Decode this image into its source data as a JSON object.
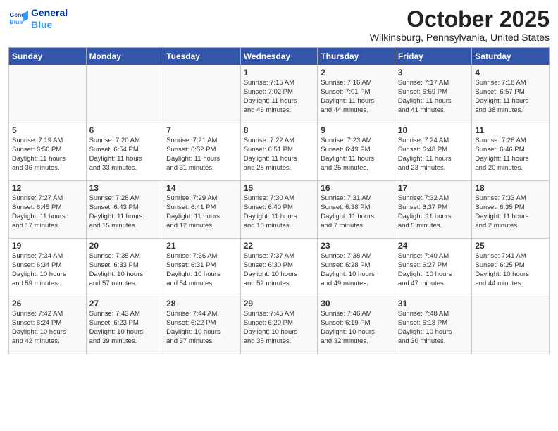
{
  "header": {
    "logo_line1": "General",
    "logo_line2": "Blue",
    "month": "October 2025",
    "location": "Wilkinsburg, Pennsylvania, United States"
  },
  "days_of_week": [
    "Sunday",
    "Monday",
    "Tuesday",
    "Wednesday",
    "Thursday",
    "Friday",
    "Saturday"
  ],
  "weeks": [
    [
      {
        "day": "",
        "text": ""
      },
      {
        "day": "",
        "text": ""
      },
      {
        "day": "",
        "text": ""
      },
      {
        "day": "1",
        "text": "Sunrise: 7:15 AM\nSunset: 7:02 PM\nDaylight: 11 hours\nand 46 minutes."
      },
      {
        "day": "2",
        "text": "Sunrise: 7:16 AM\nSunset: 7:01 PM\nDaylight: 11 hours\nand 44 minutes."
      },
      {
        "day": "3",
        "text": "Sunrise: 7:17 AM\nSunset: 6:59 PM\nDaylight: 11 hours\nand 41 minutes."
      },
      {
        "day": "4",
        "text": "Sunrise: 7:18 AM\nSunset: 6:57 PM\nDaylight: 11 hours\nand 38 minutes."
      }
    ],
    [
      {
        "day": "5",
        "text": "Sunrise: 7:19 AM\nSunset: 6:56 PM\nDaylight: 11 hours\nand 36 minutes."
      },
      {
        "day": "6",
        "text": "Sunrise: 7:20 AM\nSunset: 6:54 PM\nDaylight: 11 hours\nand 33 minutes."
      },
      {
        "day": "7",
        "text": "Sunrise: 7:21 AM\nSunset: 6:52 PM\nDaylight: 11 hours\nand 31 minutes."
      },
      {
        "day": "8",
        "text": "Sunrise: 7:22 AM\nSunset: 6:51 PM\nDaylight: 11 hours\nand 28 minutes."
      },
      {
        "day": "9",
        "text": "Sunrise: 7:23 AM\nSunset: 6:49 PM\nDaylight: 11 hours\nand 25 minutes."
      },
      {
        "day": "10",
        "text": "Sunrise: 7:24 AM\nSunset: 6:48 PM\nDaylight: 11 hours\nand 23 minutes."
      },
      {
        "day": "11",
        "text": "Sunrise: 7:26 AM\nSunset: 6:46 PM\nDaylight: 11 hours\nand 20 minutes."
      }
    ],
    [
      {
        "day": "12",
        "text": "Sunrise: 7:27 AM\nSunset: 6:45 PM\nDaylight: 11 hours\nand 17 minutes."
      },
      {
        "day": "13",
        "text": "Sunrise: 7:28 AM\nSunset: 6:43 PM\nDaylight: 11 hours\nand 15 minutes."
      },
      {
        "day": "14",
        "text": "Sunrise: 7:29 AM\nSunset: 6:41 PM\nDaylight: 11 hours\nand 12 minutes."
      },
      {
        "day": "15",
        "text": "Sunrise: 7:30 AM\nSunset: 6:40 PM\nDaylight: 11 hours\nand 10 minutes."
      },
      {
        "day": "16",
        "text": "Sunrise: 7:31 AM\nSunset: 6:38 PM\nDaylight: 11 hours\nand 7 minutes."
      },
      {
        "day": "17",
        "text": "Sunrise: 7:32 AM\nSunset: 6:37 PM\nDaylight: 11 hours\nand 5 minutes."
      },
      {
        "day": "18",
        "text": "Sunrise: 7:33 AM\nSunset: 6:35 PM\nDaylight: 11 hours\nand 2 minutes."
      }
    ],
    [
      {
        "day": "19",
        "text": "Sunrise: 7:34 AM\nSunset: 6:34 PM\nDaylight: 10 hours\nand 59 minutes."
      },
      {
        "day": "20",
        "text": "Sunrise: 7:35 AM\nSunset: 6:33 PM\nDaylight: 10 hours\nand 57 minutes."
      },
      {
        "day": "21",
        "text": "Sunrise: 7:36 AM\nSunset: 6:31 PM\nDaylight: 10 hours\nand 54 minutes."
      },
      {
        "day": "22",
        "text": "Sunrise: 7:37 AM\nSunset: 6:30 PM\nDaylight: 10 hours\nand 52 minutes."
      },
      {
        "day": "23",
        "text": "Sunrise: 7:38 AM\nSunset: 6:28 PM\nDaylight: 10 hours\nand 49 minutes."
      },
      {
        "day": "24",
        "text": "Sunrise: 7:40 AM\nSunset: 6:27 PM\nDaylight: 10 hours\nand 47 minutes."
      },
      {
        "day": "25",
        "text": "Sunrise: 7:41 AM\nSunset: 6:25 PM\nDaylight: 10 hours\nand 44 minutes."
      }
    ],
    [
      {
        "day": "26",
        "text": "Sunrise: 7:42 AM\nSunset: 6:24 PM\nDaylight: 10 hours\nand 42 minutes."
      },
      {
        "day": "27",
        "text": "Sunrise: 7:43 AM\nSunset: 6:23 PM\nDaylight: 10 hours\nand 39 minutes."
      },
      {
        "day": "28",
        "text": "Sunrise: 7:44 AM\nSunset: 6:22 PM\nDaylight: 10 hours\nand 37 minutes."
      },
      {
        "day": "29",
        "text": "Sunrise: 7:45 AM\nSunset: 6:20 PM\nDaylight: 10 hours\nand 35 minutes."
      },
      {
        "day": "30",
        "text": "Sunrise: 7:46 AM\nSunset: 6:19 PM\nDaylight: 10 hours\nand 32 minutes."
      },
      {
        "day": "31",
        "text": "Sunrise: 7:48 AM\nSunset: 6:18 PM\nDaylight: 10 hours\nand 30 minutes."
      },
      {
        "day": "",
        "text": ""
      }
    ]
  ]
}
